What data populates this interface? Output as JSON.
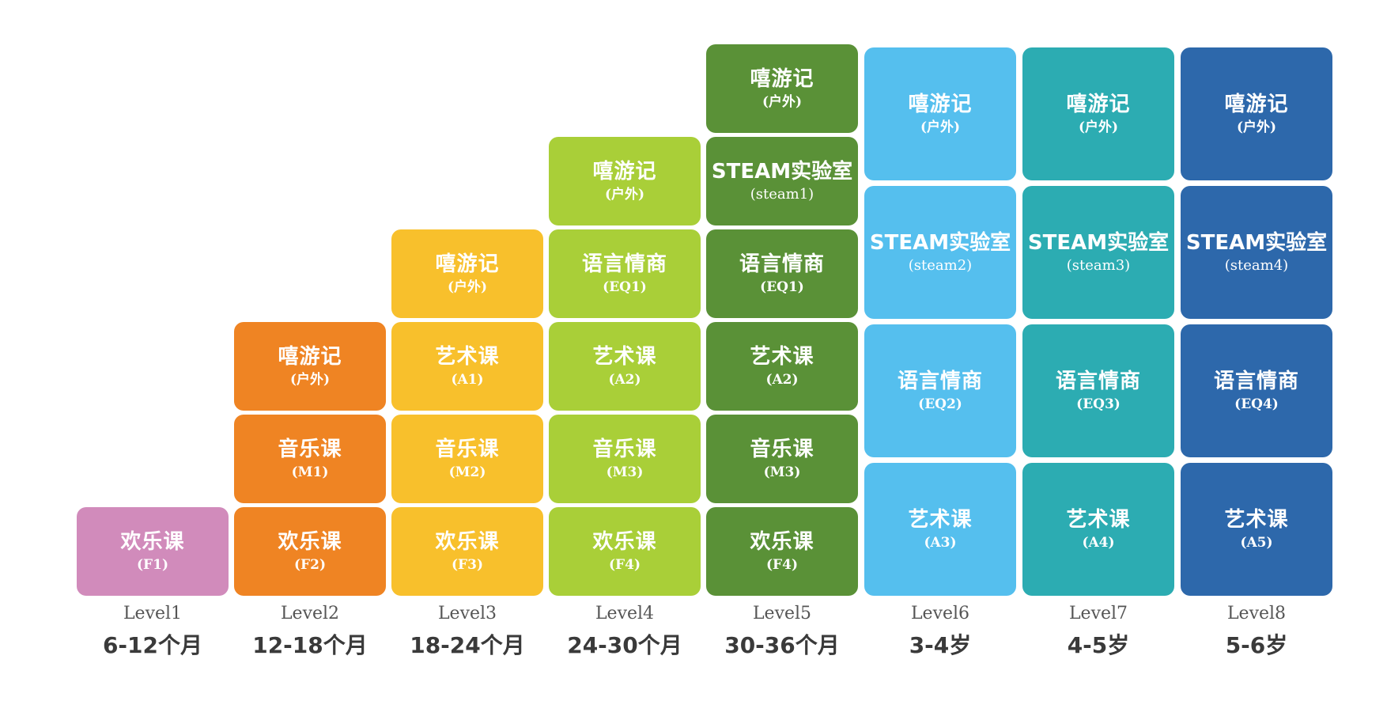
{
  "levels": [
    {
      "name": "Level1",
      "age": "6-12个月",
      "color": "#d18bbb",
      "blocks": [
        {
          "title": "欢乐课",
          "code": "(F1)"
        }
      ]
    },
    {
      "name": "Level2",
      "age": "12-18个月",
      "color": "#ef8423",
      "blocks": [
        {
          "title": "嘻游记",
          "code": "(户外)"
        },
        {
          "title": "音乐课",
          "code": "(M1)"
        },
        {
          "title": "欢乐课",
          "code": "(F2)"
        }
      ]
    },
    {
      "name": "Level3",
      "age": "18-24个月",
      "color": "#f8c02c",
      "blocks": [
        {
          "title": "嘻游记",
          "code": "(户外)"
        },
        {
          "title": "艺术课",
          "code": "(A1)"
        },
        {
          "title": "音乐课",
          "code": "(M2)"
        },
        {
          "title": "欢乐课",
          "code": "(F3)"
        }
      ]
    },
    {
      "name": "Level4",
      "age": "24-30个月",
      "color": "#a9cf38",
      "blocks": [
        {
          "title": "嘻游记",
          "code": "(户外)"
        },
        {
          "title": "语言情商",
          "code": "(EQ1)"
        },
        {
          "title": "艺术课",
          "code": "(A2)"
        },
        {
          "title": "音乐课",
          "code": "(M3)"
        },
        {
          "title": "欢乐课",
          "code": "(F4)"
        }
      ]
    },
    {
      "name": "Level5",
      "age": "30-36个月",
      "color": "#5a9137",
      "blocks": [
        {
          "title": "嘻游记",
          "code": "(户外)"
        },
        {
          "title": "STEAM实验室",
          "code": "(steam1)"
        },
        {
          "title": "语言情商",
          "code": "(EQ1)"
        },
        {
          "title": "艺术课",
          "code": "(A2)"
        },
        {
          "title": "音乐课",
          "code": "(M3)"
        },
        {
          "title": "欢乐课",
          "code": "(F4)"
        }
      ]
    },
    {
      "name": "Level6",
      "age": "3-4岁",
      "color": "#55bfee",
      "blocks": [
        {
          "title": "嘻游记",
          "code": "(户外)"
        },
        {
          "title": "STEAM实验室",
          "code": "(steam2)"
        },
        {
          "title": "语言情商",
          "code": "(EQ2)"
        },
        {
          "title": "艺术课",
          "code": "(A3)"
        }
      ]
    },
    {
      "name": "Level7",
      "age": "4-5岁",
      "color": "#2cacb2",
      "blocks": [
        {
          "title": "嘻游记",
          "code": "(户外)"
        },
        {
          "title": "STEAM实验室",
          "code": "(steam3)"
        },
        {
          "title": "语言情商",
          "code": "(EQ3)"
        },
        {
          "title": "艺术课",
          "code": "(A4)"
        }
      ]
    },
    {
      "name": "Level8",
      "age": "5-6岁",
      "color": "#2d68ab",
      "blocks": [
        {
          "title": "嘻游记",
          "code": "(户外)"
        },
        {
          "title": "STEAM实验室",
          "code": "(steam4)"
        },
        {
          "title": "语言情商",
          "code": "(EQ4)"
        },
        {
          "title": "艺术课",
          "code": "(A5)"
        }
      ]
    }
  ]
}
